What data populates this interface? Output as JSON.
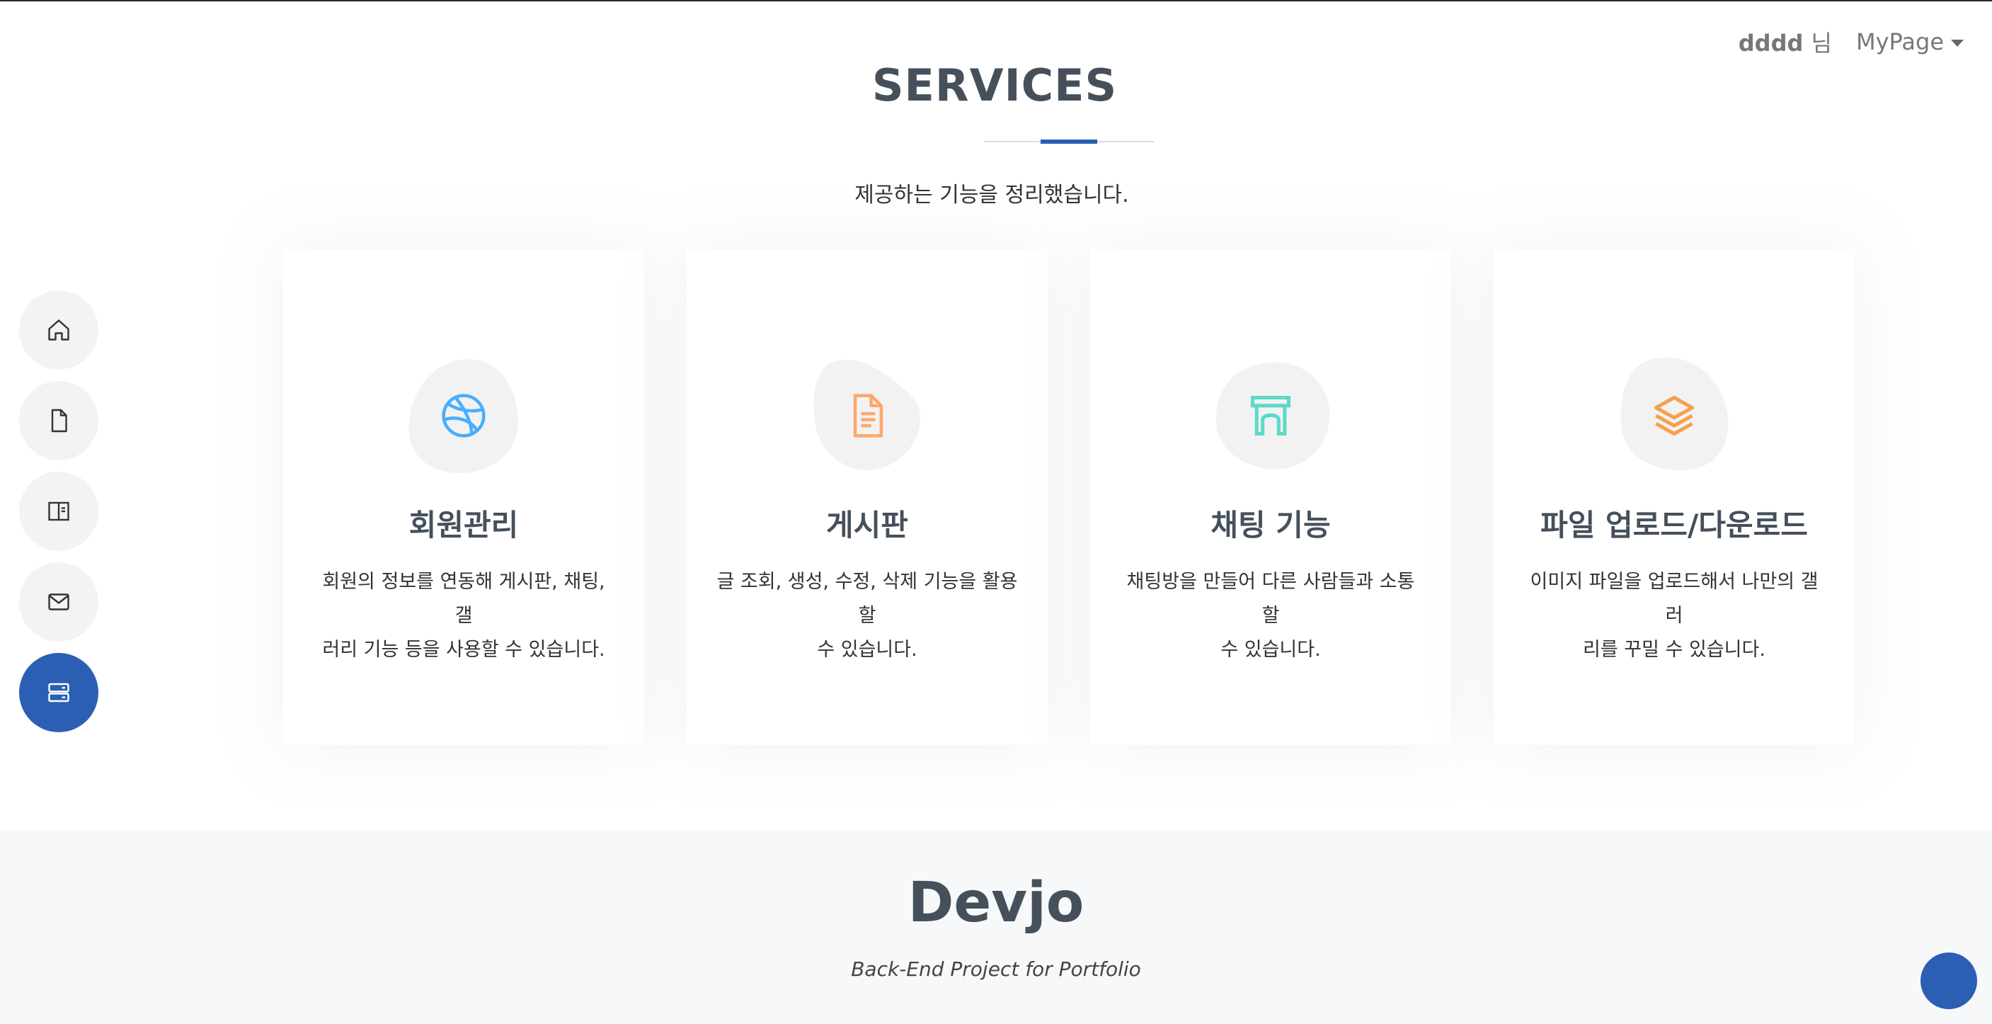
{
  "header": {
    "username": "dddd",
    "username_suffix": "님",
    "mypage_label": "MyPage"
  },
  "section": {
    "title": "SERVICES",
    "description": "제공하는 기능을 정리했습니다."
  },
  "sidenav": {
    "items": [
      {
        "icon": "home-icon",
        "active": false
      },
      {
        "icon": "file-icon",
        "active": false
      },
      {
        "icon": "book-icon",
        "active": false
      },
      {
        "icon": "envelope-icon",
        "active": false
      },
      {
        "icon": "server-icon",
        "active": true
      }
    ]
  },
  "cards": [
    {
      "icon": "dribbble-icon",
      "color": "#47aeff",
      "title": "회원관리",
      "desc_line1": "회원의 정보를 연동해 게시판, 채팅, 갤",
      "desc_line2": "러리 기능 등을 사용할 수 있습니다."
    },
    {
      "icon": "file-text-icon",
      "color": "#ffa76e",
      "title": "게시판",
      "desc_line1": "글 조회, 생성, 수정, 삭제 기능을 활용할",
      "desc_line2": "수 있습니다."
    },
    {
      "icon": "arch-icon",
      "color": "#5dd9c8",
      "title": "채팅 기능",
      "desc_line1": "채팅방을 만들어 다른 사람들과 소통할",
      "desc_line2": "수 있습니다."
    },
    {
      "icon": "layers-icon",
      "color": "#f5a04c",
      "title": "파일 업로드/다운로드",
      "desc_line1": "이미지 파일을 업로드해서 나만의 갤러",
      "desc_line2": "리를 꾸밀 수 있습니다."
    }
  ],
  "footer": {
    "brand": "Devjo",
    "tagline": "Back-End Project for Portfolio"
  },
  "colors": {
    "accent": "#2b5fb4",
    "blob": "#f2f2f2",
    "title": "#45505b"
  }
}
